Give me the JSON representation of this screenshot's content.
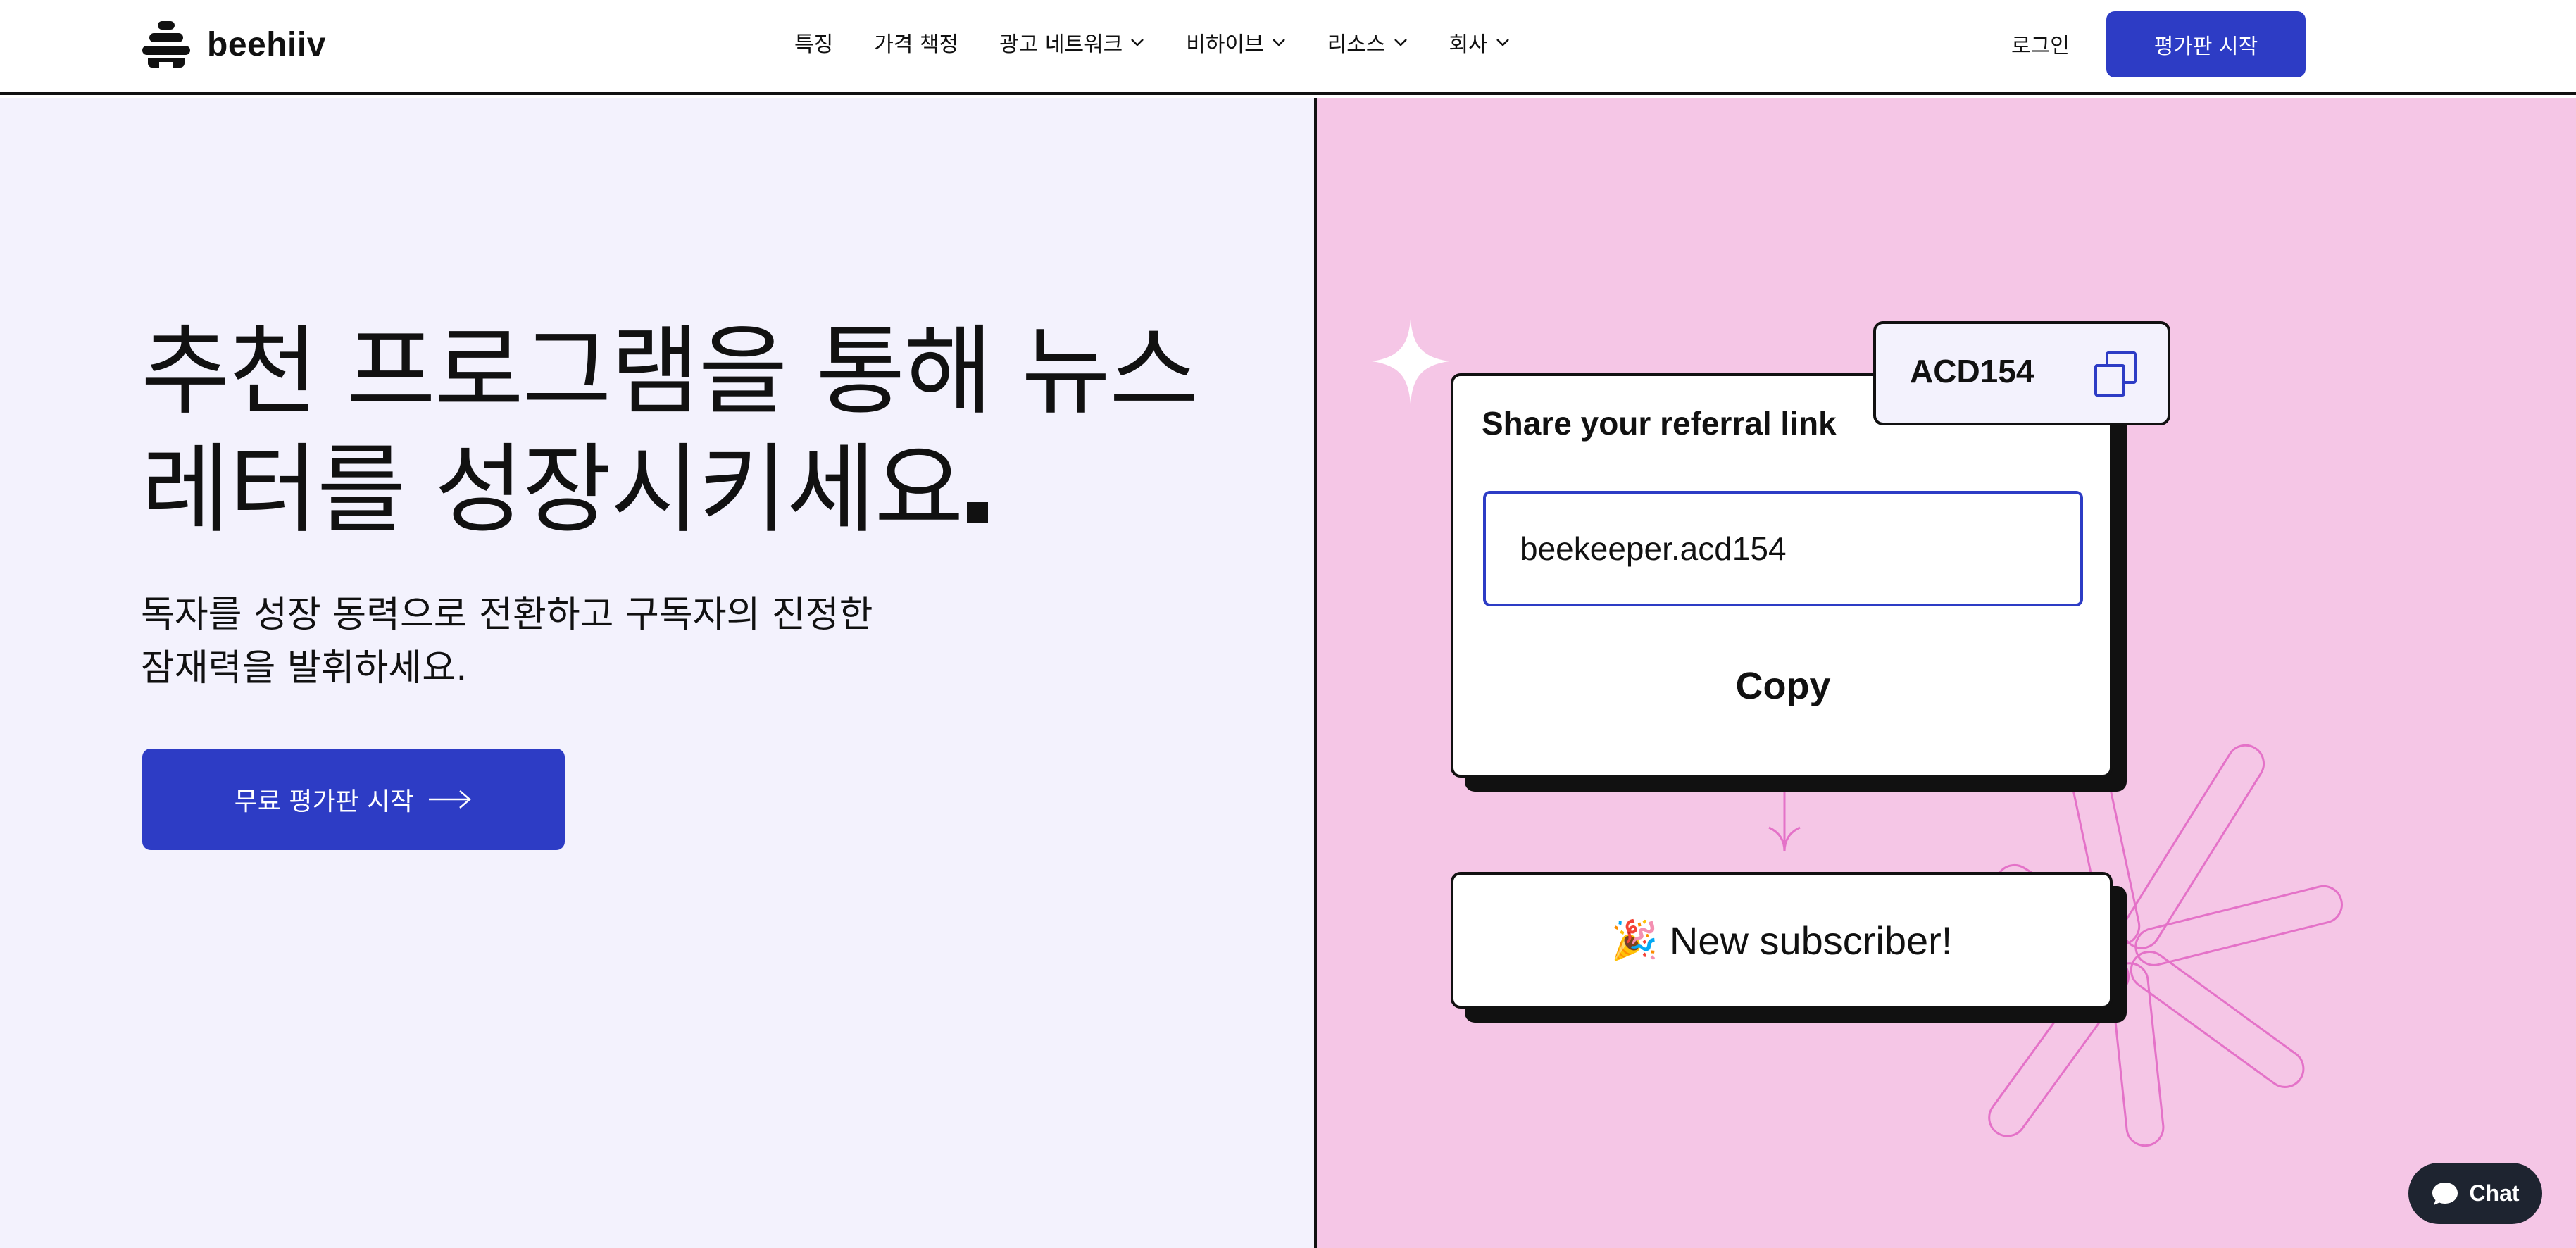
{
  "brand": {
    "name": "beehiiv",
    "logo_icon": "beehive-icon"
  },
  "nav": {
    "items": [
      {
        "label": "특징",
        "has_dropdown": false
      },
      {
        "label": "가격 책정",
        "has_dropdown": false
      },
      {
        "label": "광고 네트워크",
        "has_dropdown": true
      },
      {
        "label": "비하이브",
        "has_dropdown": true
      },
      {
        "label": "리소스",
        "has_dropdown": true
      },
      {
        "label": "회사",
        "has_dropdown": true
      }
    ],
    "login_label": "로그인",
    "cta_label": "평가판 시작"
  },
  "hero": {
    "title_line1": "추천 프로그램을 통해 뉴스",
    "title_line2": "레터를 성장시키세요",
    "subtitle_line1": "독자를 성장 동력으로 전환하고 구독자의 진정한",
    "subtitle_line2": "잠재력을 발휘하세요.",
    "cta_label": "무료 평가판 시작"
  },
  "illustration": {
    "referral_code": "ACD154",
    "card_title": "Share your referral link",
    "link_value": "beekeeper.acd154",
    "copy_label": "Copy",
    "subscriber_emoji": "🎉",
    "subscriber_text": "New subscriber!"
  },
  "chat": {
    "label": "Chat"
  },
  "colors": {
    "accent": "#2d3cc5",
    "left_bg": "#f3f2fd",
    "right_bg": "#f5c6e6",
    "deco_pink": "#e472c8",
    "chat_bg": "#1e2430"
  }
}
